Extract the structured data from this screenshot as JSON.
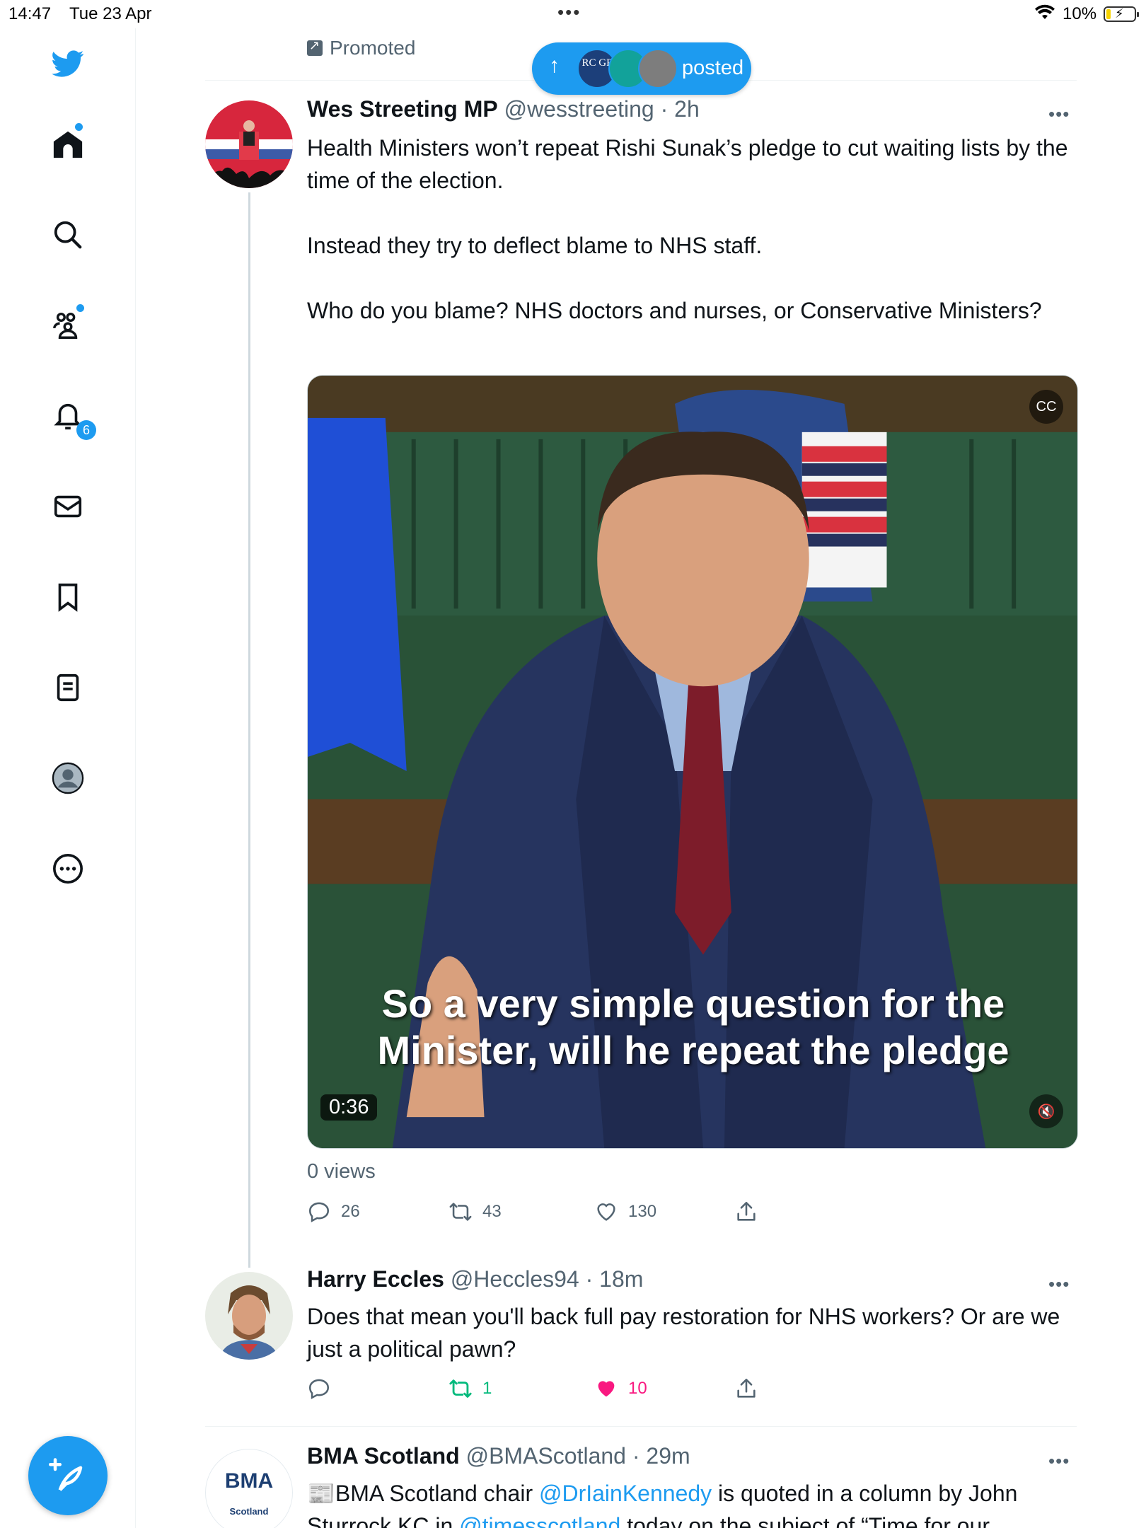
{
  "status_bar": {
    "time": "14:47",
    "date": "Tue 23 Apr",
    "battery": "10%"
  },
  "sidebar": {
    "notifications_badge": "6",
    "items": [
      "twitter-logo",
      "home-icon",
      "search-icon",
      "communities-icon",
      "notifications-icon",
      "messages-icon",
      "bookmarks-icon",
      "lists-icon",
      "profile-icon",
      "more-icon"
    ]
  },
  "timeline": {
    "promoted_label": "Promoted",
    "new_posts_pill": {
      "label": "posted",
      "avatar_text": "RC GP"
    },
    "tweets": [
      {
        "name": "Wes Streeting MP",
        "handle": "@wesstreeting",
        "time": "· 2h",
        "text": [
          "Health Ministers won’t repeat Rishi Sunak’s pledge to cut waiting lists by the time of the election.",
          "Instead they try to deflect blame to NHS staff.",
          "Who do you blame? NHS doctors and nurses, or Conservative Ministers?"
        ],
        "video": {
          "caption_line1": "So a very simple question for the",
          "caption_line2": "Minister, will he repeat the pledge",
          "duration": "0:36"
        },
        "views": "0 views",
        "replies": "26",
        "retweets": "43",
        "likes": "130"
      },
      {
        "name": "Harry Eccles",
        "handle": "@Heccles94",
        "time": "· 18m",
        "text": "Does that mean you'll back full pay restoration for NHS workers? Or are we just a political pawn?",
        "replies": "",
        "retweets": "1",
        "likes": "10"
      },
      {
        "name": "BMA Scotland",
        "handle": "@BMAScotland",
        "time": "· 29m",
        "avatar_logo": "BMA",
        "avatar_sub": "Scotland",
        "text_a": "📰BMA Scotland chair ",
        "mention1": "@DrIainKennedy",
        "text_b": " is quoted in a column by John Sturrock KC in ",
        "mention2": "@timesscotland",
        "text_c": " today on the subject of “Time for our"
      }
    ]
  },
  "colors": {
    "accent": "#1d9bf0",
    "text": "#0f1419",
    "secondary": "#536471",
    "retweet_active": "#00ba7c",
    "like_active": "#f91880"
  }
}
